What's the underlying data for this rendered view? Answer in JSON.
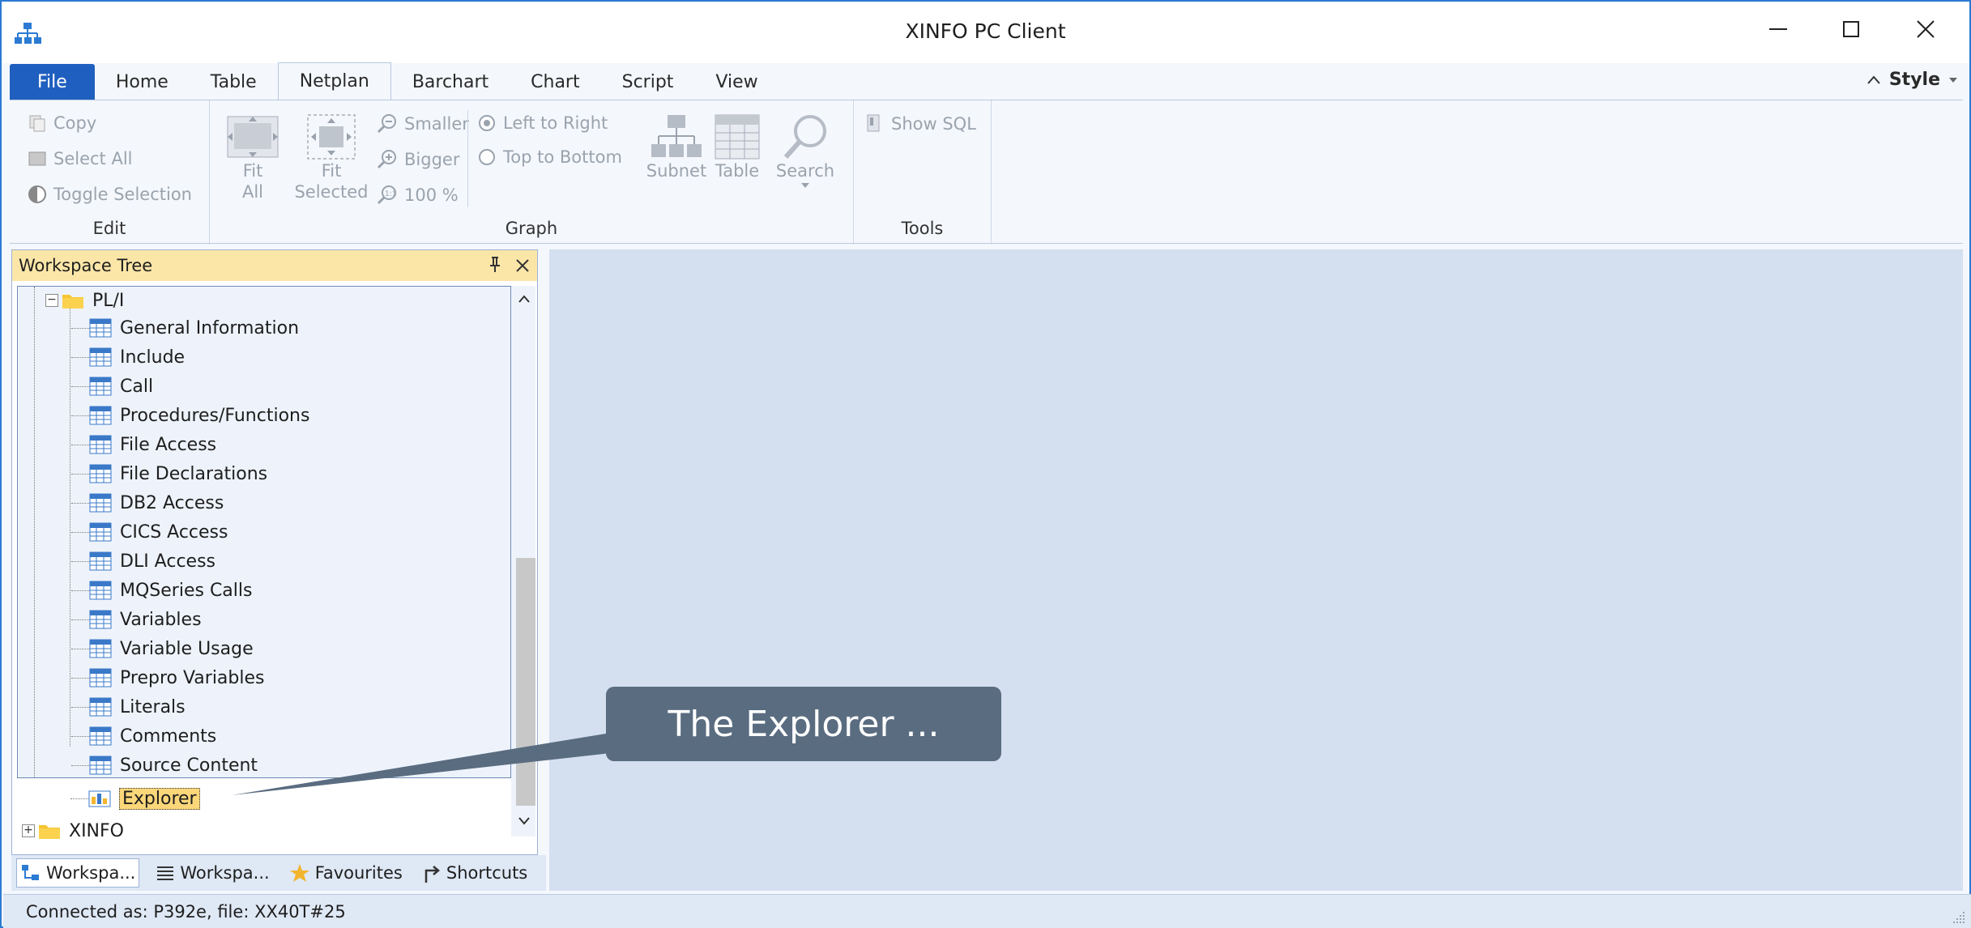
{
  "window": {
    "title": "XINFO PC Client"
  },
  "tabs": [
    {
      "label": "File"
    },
    {
      "label": "Home"
    },
    {
      "label": "Table"
    },
    {
      "label": "Netplan"
    },
    {
      "label": "Barchart"
    },
    {
      "label": "Chart"
    },
    {
      "label": "Script"
    },
    {
      "label": "View"
    }
  ],
  "active_tab": "Netplan",
  "style_button": "Style",
  "ribbon": {
    "edit": {
      "label": "Edit",
      "copy": "Copy",
      "select_all": "Select All",
      "toggle_selection": "Toggle Selection"
    },
    "graph": {
      "label": "Graph",
      "fit_all_1": "Fit",
      "fit_all_2": "All",
      "fit_selected_1": "Fit",
      "fit_selected_2": "Selected",
      "smaller": "Smaller",
      "bigger": "Bigger",
      "zoom_100": "100 %",
      "left_to_right": "Left to Right",
      "top_to_bottom": "Top to Bottom",
      "subnet": "Subnet",
      "table": "Table",
      "search": "Search"
    },
    "tools": {
      "label": "Tools",
      "show_sql": "Show SQL"
    }
  },
  "workspace_pane": {
    "title": "Workspace Tree",
    "tree": {
      "folder": "PL/I",
      "items": [
        "General Information",
        "Include",
        "Call",
        "Procedures/Functions",
        "File Access",
        "File Declarations",
        "DB2 Access",
        "CICS Access",
        "DLI Access",
        "MQSeries Calls",
        "Variables",
        "Variable Usage",
        "Prepro Variables",
        "Literals",
        "Comments",
        "Source Content"
      ],
      "selected_item": "Explorer",
      "sibling_folder": "XINFO"
    },
    "bottom_tabs": [
      "Workspa...",
      "Workspa...",
      "Favourites",
      "Shortcuts"
    ]
  },
  "status": {
    "text": "Connected as: P392e, file: XX40T#25"
  },
  "callout": {
    "text": "The Explorer ..."
  },
  "colors": {
    "accent": "#1f5fbf",
    "pane_header": "#fbe6a8",
    "callout_bg": "#5a6c80",
    "main_bg": "#d4e0f0"
  }
}
